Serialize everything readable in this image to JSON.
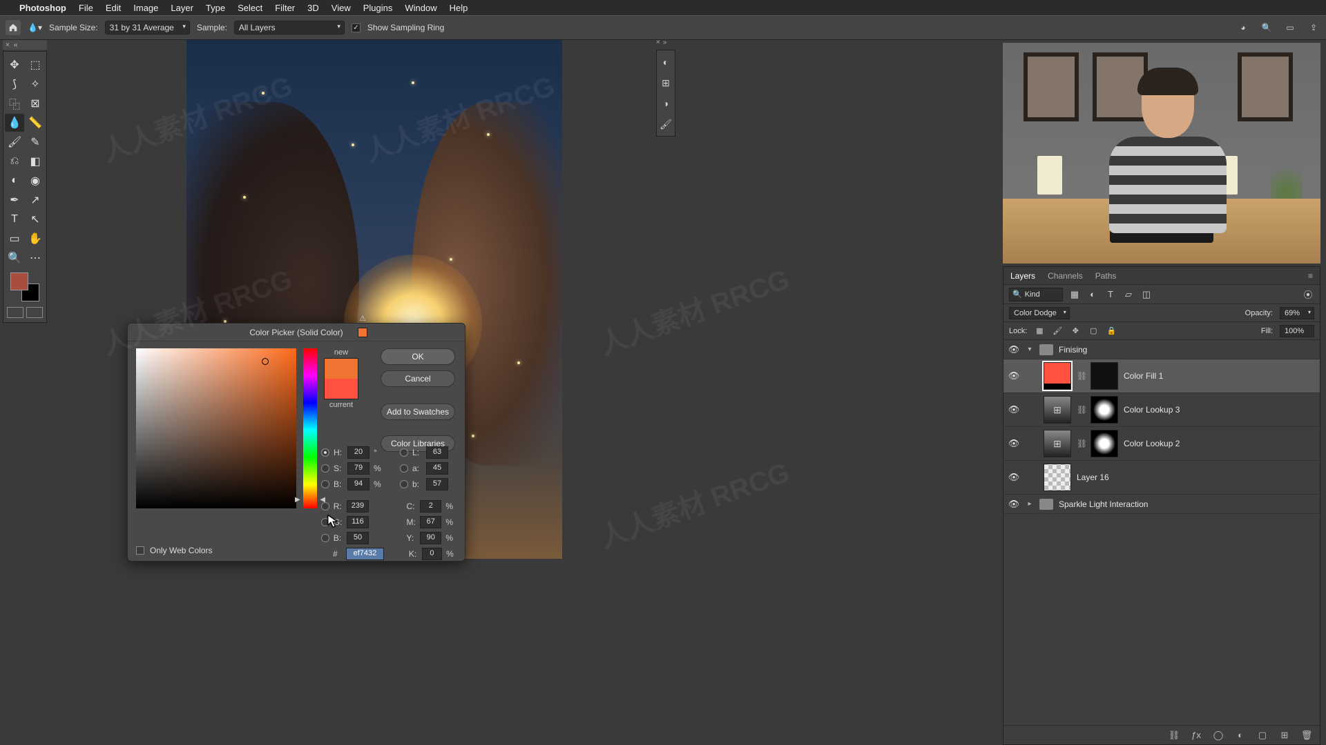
{
  "menubar": {
    "app": "Photoshop",
    "items": [
      "File",
      "Edit",
      "Image",
      "Layer",
      "Type",
      "Select",
      "Filter",
      "3D",
      "View",
      "Plugins",
      "Window",
      "Help"
    ]
  },
  "optbar": {
    "sample_size_label": "Sample Size:",
    "sample_size_value": "31 by 31 Average",
    "sample_label": "Sample:",
    "sample_value": "All Layers",
    "show_ring": "Show Sampling Ring"
  },
  "dialog": {
    "title": "Color Picker (Solid Color)",
    "new_label": "new",
    "current_label": "current",
    "ok": "OK",
    "cancel": "Cancel",
    "add_swatch": "Add to Swatches",
    "libraries": "Color Libraries",
    "web_only": "Only Web Colors",
    "H": "20",
    "S": "79",
    "B": "94",
    "R": "239",
    "G": "116",
    "Bb": "50",
    "L": "63",
    "a": "45",
    "b": "57",
    "C": "2",
    "M": "67",
    "Y": "90",
    "K": "0",
    "hex": "ef7432"
  },
  "panels": {
    "tabs": [
      "Layers",
      "Channels",
      "Paths"
    ],
    "filter_placeholder": "Kind",
    "blend_mode": "Color Dodge",
    "opacity_label": "Opacity:",
    "opacity_value": "69%",
    "lock_label": "Lock:",
    "fill_label": "Fill:",
    "fill_value": "100%",
    "group1": "Finising",
    "layer_colorfill": "Color Fill 1",
    "layer_lookup3": "Color Lookup 3",
    "layer_lookup2": "Color Lookup 2",
    "layer_layer16": "Layer 16",
    "group2": "Sparkle Light Interaction"
  },
  "watermark": "人人素材 RRCG"
}
